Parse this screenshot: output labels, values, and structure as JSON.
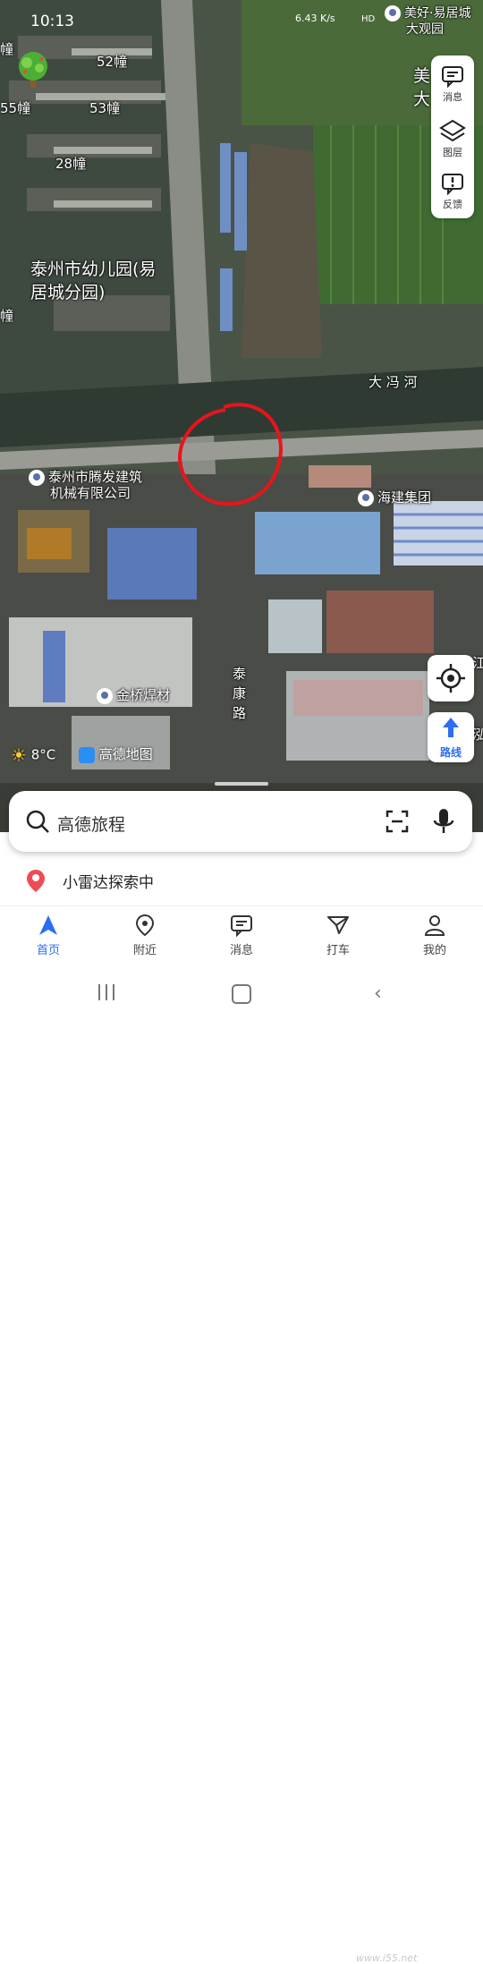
{
  "status_bar": {
    "time": "10:13",
    "net_speed": "6.43 K/s",
    "signals": "HD"
  },
  "map": {
    "labels": {
      "b52": "52幢",
      "b55": "55幢",
      "b53": "53幢",
      "b28": "28幢",
      "kindergarten_line1": "泰州市幼儿园(易",
      "kindergarten_line2": "居城分园)",
      "river": "大 冯 河",
      "company_line1": "泰州市腾发建筑",
      "company_line2": "机械有限公司",
      "haijian": "海建集团",
      "jinqiao": "金桥焊材",
      "road_1": "泰",
      "road_2": "康",
      "road_3": "路",
      "top_right_line1": "美好·易居城",
      "top_right_line2": "大观园",
      "edge_mei": "美",
      "edge_da": "大",
      "edge_jiang": "江",
      "edge_hong": "泓",
      "edge_zhuang": "幢"
    }
  },
  "toolbar": {
    "message": "消息",
    "layers": "图层",
    "feedback": "反馈"
  },
  "route_button": "路线",
  "weather": {
    "temp": "8°C"
  },
  "brand": "高德地图",
  "search": {
    "placeholder": "高德旅程"
  },
  "radar": {
    "text": "小雷达探索中"
  },
  "nav": {
    "home": "首页",
    "nearby": "附近",
    "messages": "消息",
    "taxi": "打车",
    "mine": "我的"
  },
  "watermark": "www.i55.net",
  "colors": {
    "accent": "#2a6ef2",
    "annotation": "#e8141c",
    "radar_pin": "#ef4b57"
  }
}
